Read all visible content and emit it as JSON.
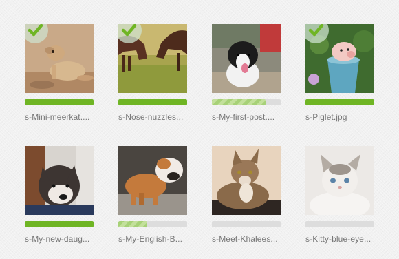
{
  "files": [
    {
      "name": "s-Mini-meerkat....",
      "progress": 1.0,
      "uploaded": true,
      "image": "meerkat"
    },
    {
      "name": "s-Nose-nuzzles...",
      "progress": 1.0,
      "uploaded": true,
      "image": "horses"
    },
    {
      "name": "s-My-first-post....",
      "progress": 0.78,
      "uploaded": false,
      "image": "puppy"
    },
    {
      "name": "s-Piglet.jpg",
      "progress": 1.0,
      "uploaded": true,
      "image": "piglet"
    },
    {
      "name": "s-My-new-daug...",
      "progress": 1.0,
      "uploaded": true,
      "image": "husky"
    },
    {
      "name": "s-My-English-B...",
      "progress": 0.42,
      "uploaded": false,
      "image": "bulldog"
    },
    {
      "name": "s-Meet-Khalees...",
      "progress": 0.0,
      "uploaded": false,
      "image": "cat-tabby"
    },
    {
      "name": "s-Kitty-blue-eye...",
      "progress": 0.0,
      "uploaded": false,
      "image": "cat-white"
    }
  ],
  "colors": {
    "complete": "#6fb524",
    "in_progress": "#a7d177",
    "track": "#dddddd",
    "check": "#6fb524"
  }
}
